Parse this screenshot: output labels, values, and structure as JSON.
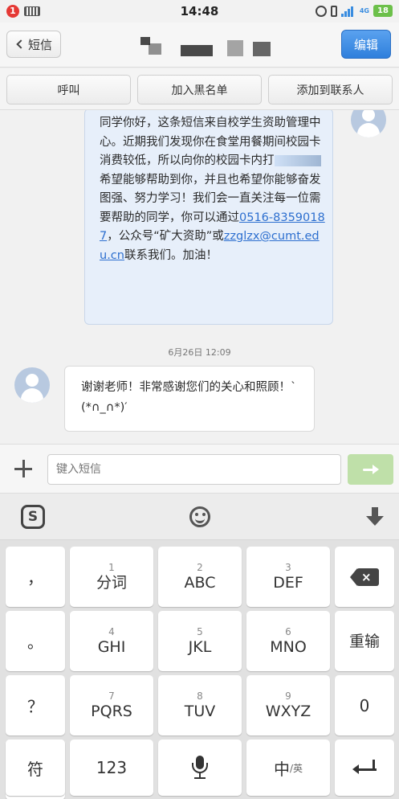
{
  "status_bar": {
    "time": "14:48",
    "notification_count": "1",
    "network": "4G",
    "battery": "18",
    "icons": [
      "notification-icon",
      "keyboard-icon",
      "alarm-icon",
      "vibrate-icon",
      "signal-icon",
      "battery-icon"
    ]
  },
  "header": {
    "back_label": "短信",
    "edit_label": "编辑"
  },
  "actions": {
    "call": "呼叫",
    "blacklist": "加入黑名单",
    "add_contact": "添加到联系人"
  },
  "messages": {
    "outgoing": {
      "part1": "同学你好，这条短信来自校学生资助管理中心。近期我们发现你在食堂用餐期间校园卡消费较低，所以向你的校园卡内打",
      "part2": "希望能够帮助到你，并且也希望你能够奋发图强、努力学习！我们会一直关注每一位需要帮助的同学，你可以通过",
      "phone": "0516-83590187",
      "part3": "，公众号“矿大资助”或",
      "email": "zzglzx@cumt.edu.cn",
      "part4": "联系我们。加油！"
    },
    "timestamp": "6月26日 12:09",
    "incoming": "谢谢老师！非常感谢您们的关心和照顾！`(*∩_∩*)′"
  },
  "compose": {
    "placeholder": "键入短信"
  },
  "keyboard": {
    "left_column": [
      "，",
      "。",
      "？",
      "！"
    ],
    "keys": [
      {
        "num": "1",
        "label": "分词"
      },
      {
        "num": "2",
        "label": "ABC"
      },
      {
        "num": "3",
        "label": "DEF"
      },
      {
        "num": "4",
        "label": "GHI"
      },
      {
        "num": "5",
        "label": "JKL"
      },
      {
        "num": "6",
        "label": "MNO"
      },
      {
        "num": "7",
        "label": "PQRS"
      },
      {
        "num": "8",
        "label": "TUV"
      },
      {
        "num": "9",
        "label": "WXYZ"
      }
    ],
    "reenter": "重输",
    "zero": "0",
    "symbol": "符",
    "numeric": "123",
    "lang_main": "中",
    "lang_sub": "/英",
    "toolbar_logo": "S"
  },
  "colors": {
    "accent": "#2f7fdc",
    "outgoing_bubble": "#e7effa",
    "send_button": "#bfe0a9",
    "badge": "#e53935",
    "battery": "#6cc04a"
  }
}
